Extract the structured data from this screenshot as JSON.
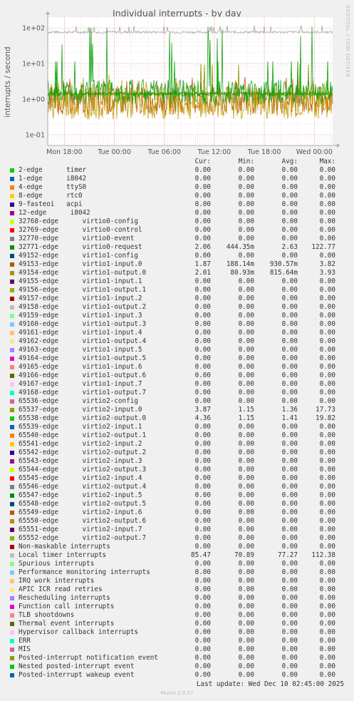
{
  "chart_data": {
    "type": "line",
    "title": "Individual interrupts - by day",
    "ylabel": "interrupts / second",
    "yscale": "log",
    "ylim": [
      0.05,
      200
    ],
    "yticks": [
      "1e-01",
      "1e+00",
      "1e+01",
      "1e+02"
    ],
    "ytick_values": [
      0.1,
      1,
      10,
      100
    ],
    "xticks": [
      "Mon 18:00",
      "Tue 00:00",
      "Tue 06:00",
      "Tue 12:00",
      "Tue 18:00",
      "Wed 00:00"
    ],
    "xtick_hours": [
      0,
      6,
      12,
      18,
      24,
      30
    ],
    "xlim_hours": [
      -2,
      32.2
    ],
    "grid": true,
    "colors": {
      "2-edge timer": "#00cc00",
      "32771-edge virtio0-request": "#17a117",
      "49153-edge virtio1-input.0": "#b45f06",
      "49154-edge virtio1-output.0": "#c39a00",
      "Local timer interrupts": "#a8a8a8",
      "65537-edge virtio2-input.0": "#8e8e00",
      "65538-edge virtio2-output.0": "#00a300"
    }
  },
  "legend_header": {
    "cur": "Cur:",
    "min": "Min:",
    "avg": "Avg:",
    "max": "Max:"
  },
  "legend": [
    {
      "name": "2-edge      timer",
      "color": "#00cc00",
      "cur": "0.00",
      "min": "0.00",
      "avg": "0.00",
      "max": "0.00"
    },
    {
      "name": "1-edge      i8042",
      "color": "#0066b3",
      "cur": "0.00",
      "min": "0.00",
      "avg": "0.00",
      "max": "0.00"
    },
    {
      "name": "4-edge      ttyS0",
      "color": "#ff8000",
      "cur": "0.00",
      "min": "0.00",
      "avg": "0.00",
      "max": "0.00"
    },
    {
      "name": "8-edge      rtc0",
      "color": "#ffcc00",
      "cur": "0.00",
      "min": "0.00",
      "avg": "0.00",
      "max": "0.00"
    },
    {
      "name": "9-fasteoi   acpi",
      "color": "#330099",
      "cur": "0.00",
      "min": "0.00",
      "avg": "0.00",
      "max": "0.00"
    },
    {
      "name": "12-edge      i8042",
      "color": "#990099",
      "cur": "0.00",
      "min": "0.00",
      "avg": "0.00",
      "max": "0.00"
    },
    {
      "name": "32768-edge      virtio0-config",
      "color": "#ccff00",
      "cur": "0.00",
      "min": "0.00",
      "avg": "0.00",
      "max": "0.00"
    },
    {
      "name": "32769-edge      virtio0-control",
      "color": "#ff0000",
      "cur": "0.00",
      "min": "0.00",
      "avg": "0.00",
      "max": "0.00"
    },
    {
      "name": "32770-edge      virtio0-event",
      "color": "#808080",
      "cur": "0.00",
      "min": "0.00",
      "avg": "0.00",
      "max": "0.00"
    },
    {
      "name": "32771-edge      virtio0-request",
      "color": "#008f00",
      "cur": "2.06",
      "min": "444.35m",
      "avg": "2.63",
      "max": "122.77"
    },
    {
      "name": "49152-edge      virtio1-config",
      "color": "#00487d",
      "cur": "0.00",
      "min": "0.00",
      "avg": "0.00",
      "max": "0.00"
    },
    {
      "name": "49153-edge      virtio1-input.0",
      "color": "#b35a00",
      "cur": "1.87",
      "min": "188.14m",
      "avg": "930.57m",
      "max": "3.82"
    },
    {
      "name": "49154-edge      virtio1-output.0",
      "color": "#b38f00",
      "cur": "2.01",
      "min": "80.93m",
      "avg": "815.64m",
      "max": "3.93"
    },
    {
      "name": "49155-edge      virtio1-input.1",
      "color": "#6b006b",
      "cur": "0.00",
      "min": "0.00",
      "avg": "0.00",
      "max": "0.00"
    },
    {
      "name": "49156-edge      virtio1-output.1",
      "color": "#8fb300",
      "cur": "0.00",
      "min": "0.00",
      "avg": "0.00",
      "max": "0.00"
    },
    {
      "name": "49157-edge      virtio1-input.2",
      "color": "#b30000",
      "cur": "0.00",
      "min": "0.00",
      "avg": "0.00",
      "max": "0.00"
    },
    {
      "name": "49158-edge      virtio1-output.2",
      "color": "#bebebe",
      "cur": "0.00",
      "min": "0.00",
      "avg": "0.00",
      "max": "0.00"
    },
    {
      "name": "49159-edge      virtio1-input.3",
      "color": "#80ff80",
      "cur": "0.00",
      "min": "0.00",
      "avg": "0.00",
      "max": "0.00"
    },
    {
      "name": "49160-edge      virtio1-output.3",
      "color": "#80c9ff",
      "cur": "0.00",
      "min": "0.00",
      "avg": "0.00",
      "max": "0.00"
    },
    {
      "name": "49161-edge      virtio1-input.4",
      "color": "#ffc080",
      "cur": "0.00",
      "min": "0.00",
      "avg": "0.00",
      "max": "0.00"
    },
    {
      "name": "49162-edge      virtio1-output.4",
      "color": "#ffe680",
      "cur": "0.00",
      "min": "0.00",
      "avg": "0.00",
      "max": "0.00"
    },
    {
      "name": "49163-edge      virtio1-input.5",
      "color": "#aa80ff",
      "cur": "0.00",
      "min": "0.00",
      "avg": "0.00",
      "max": "0.00"
    },
    {
      "name": "49164-edge      virtio1-output.5",
      "color": "#ee00cc",
      "cur": "0.00",
      "min": "0.00",
      "avg": "0.00",
      "max": "0.00"
    },
    {
      "name": "49165-edge      virtio1-input.6",
      "color": "#ff8080",
      "cur": "0.00",
      "min": "0.00",
      "avg": "0.00",
      "max": "0.00"
    },
    {
      "name": "49166-edge      virtio1-output.6",
      "color": "#666600",
      "cur": "0.00",
      "min": "0.00",
      "avg": "0.00",
      "max": "0.00"
    },
    {
      "name": "49167-edge      virtio1-input.7",
      "color": "#ffbfff",
      "cur": "0.00",
      "min": "0.00",
      "avg": "0.00",
      "max": "0.00"
    },
    {
      "name": "49168-edge      virtio1-output.7",
      "color": "#00ffcc",
      "cur": "0.00",
      "min": "0.00",
      "avg": "0.00",
      "max": "0.00"
    },
    {
      "name": "65536-edge      virtio2-config",
      "color": "#cc6699",
      "cur": "0.00",
      "min": "0.00",
      "avg": "0.00",
      "max": "0.00"
    },
    {
      "name": "65537-edge      virtio2-input.0",
      "color": "#999900",
      "cur": "3.87",
      "min": "1.15",
      "avg": "1.36",
      "max": "17.73"
    },
    {
      "name": "65538-edge      virtio2-output.0",
      "color": "#00cc00",
      "cur": "4.36",
      "min": "1.15",
      "avg": "1.41",
      "max": "19.82"
    },
    {
      "name": "65539-edge      virtio2-input.1",
      "color": "#0066b3",
      "cur": "0.00",
      "min": "0.00",
      "avg": "0.00",
      "max": "0.00"
    },
    {
      "name": "65540-edge      virtio2-output.1",
      "color": "#ff8000",
      "cur": "0.00",
      "min": "0.00",
      "avg": "0.00",
      "max": "0.00"
    },
    {
      "name": "65541-edge      virtio2-input.2",
      "color": "#ffcc00",
      "cur": "0.00",
      "min": "0.00",
      "avg": "0.00",
      "max": "0.00"
    },
    {
      "name": "65542-edge      virtio2-output.2",
      "color": "#330099",
      "cur": "0.00",
      "min": "0.00",
      "avg": "0.00",
      "max": "0.00"
    },
    {
      "name": "65543-edge      virtio2-input.3",
      "color": "#990099",
      "cur": "0.00",
      "min": "0.00",
      "avg": "0.00",
      "max": "0.00"
    },
    {
      "name": "65544-edge      virtio2-output.3",
      "color": "#ccff00",
      "cur": "0.00",
      "min": "0.00",
      "avg": "0.00",
      "max": "0.00"
    },
    {
      "name": "65545-edge      virtio2-input.4",
      "color": "#ff0000",
      "cur": "0.00",
      "min": "0.00",
      "avg": "0.00",
      "max": "0.00"
    },
    {
      "name": "65546-edge      virtio2-output.4",
      "color": "#808080",
      "cur": "0.00",
      "min": "0.00",
      "avg": "0.00",
      "max": "0.00"
    },
    {
      "name": "65547-edge      virtio2-input.5",
      "color": "#008f00",
      "cur": "0.00",
      "min": "0.00",
      "avg": "0.00",
      "max": "0.00"
    },
    {
      "name": "65548-edge      virtio2-output.5",
      "color": "#00487d",
      "cur": "0.00",
      "min": "0.00",
      "avg": "0.00",
      "max": "0.00"
    },
    {
      "name": "65549-edge      virtio2-input.6",
      "color": "#b35a00",
      "cur": "0.00",
      "min": "0.00",
      "avg": "0.00",
      "max": "0.00"
    },
    {
      "name": "65550-edge      virtio2-output.6",
      "color": "#b38f00",
      "cur": "0.00",
      "min": "0.00",
      "avg": "0.00",
      "max": "0.00"
    },
    {
      "name": "65551-edge      virtio2-input.7",
      "color": "#6b006b",
      "cur": "0.00",
      "min": "0.00",
      "avg": "0.00",
      "max": "0.00"
    },
    {
      "name": "65552-edge      virtio2-output.7",
      "color": "#8fb300",
      "cur": "0.00",
      "min": "0.00",
      "avg": "0.00",
      "max": "0.00"
    },
    {
      "name": "Non-maskable interrupts",
      "color": "#b30000",
      "cur": "0.00",
      "min": "0.00",
      "avg": "0.00",
      "max": "0.00"
    },
    {
      "name": "Local timer interrupts",
      "color": "#bebebe",
      "cur": "85.47",
      "min": "70.89",
      "avg": "77.27",
      "max": "112.38"
    },
    {
      "name": "Spurious interrupts",
      "color": "#80ff80",
      "cur": "0.00",
      "min": "0.00",
      "avg": "0.00",
      "max": "0.00"
    },
    {
      "name": "Performance monitoring interrupts",
      "color": "#80c9ff",
      "cur": "0.00",
      "min": "0.00",
      "avg": "0.00",
      "max": "0.00"
    },
    {
      "name": "IRQ work interrupts",
      "color": "#ffc080",
      "cur": "0.00",
      "min": "0.00",
      "avg": "0.00",
      "max": "0.00"
    },
    {
      "name": "APIC ICR read retries",
      "color": "#ffe680",
      "cur": "0.00",
      "min": "0.00",
      "avg": "0.00",
      "max": "0.00"
    },
    {
      "name": "Rescheduling interrupts",
      "color": "#aa80ff",
      "cur": "0.00",
      "min": "0.00",
      "avg": "0.00",
      "max": "0.00"
    },
    {
      "name": "Function call interrupts",
      "color": "#ee00cc",
      "cur": "0.00",
      "min": "0.00",
      "avg": "0.00",
      "max": "0.00"
    },
    {
      "name": "TLB shootdowns",
      "color": "#ff8080",
      "cur": "0.00",
      "min": "0.00",
      "avg": "0.00",
      "max": "0.00"
    },
    {
      "name": "Thermal event interrupts",
      "color": "#666600",
      "cur": "0.00",
      "min": "0.00",
      "avg": "0.00",
      "max": "0.00"
    },
    {
      "name": "Hypervisor callback interrupts",
      "color": "#ffbfff",
      "cur": "0.00",
      "min": "0.00",
      "avg": "0.00",
      "max": "0.00"
    },
    {
      "name": "ERR",
      "color": "#00ffcc",
      "cur": "0.00",
      "min": "0.00",
      "avg": "0.00",
      "max": "0.00"
    },
    {
      "name": "MIS",
      "color": "#cc6699",
      "cur": "0.00",
      "min": "0.00",
      "avg": "0.00",
      "max": "0.00"
    },
    {
      "name": "Posted-interrupt notification event",
      "color": "#999900",
      "cur": "0.00",
      "min": "0.00",
      "avg": "0.00",
      "max": "0.00"
    },
    {
      "name": "Nested posted-interrupt event",
      "color": "#00cc00",
      "cur": "0.00",
      "min": "0.00",
      "avg": "0.00",
      "max": "0.00"
    },
    {
      "name": "Posted-interrupt wakeup event",
      "color": "#0066b3",
      "cur": "0.00",
      "min": "0.00",
      "avg": "0.00",
      "max": "0.00"
    }
  ],
  "watermark": "RRDTOOL / TOBI OETIKER",
  "last_update": "Last update: Wed Dec 10 02:45:00 2025",
  "version": "Munin 2.0.57"
}
